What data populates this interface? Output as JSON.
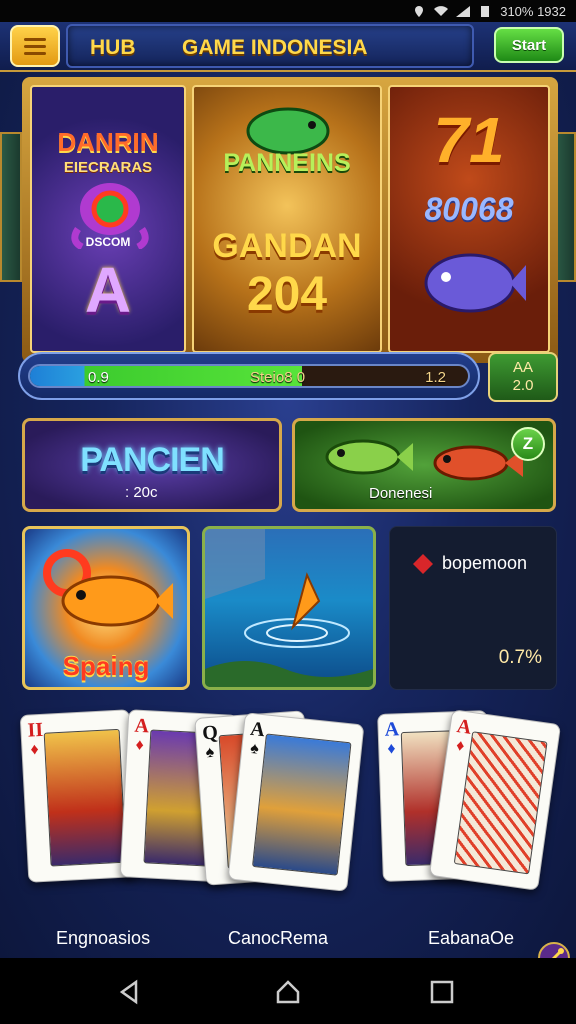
{
  "status_bar": {
    "time": "310% 1932"
  },
  "header": {
    "hub": "HUB",
    "title": "GAME INDONESIA",
    "start_label": "Start"
  },
  "banners": [
    {
      "line1": "DANRIN",
      "line2": "EIECRARAS",
      "line3": "DSCOM",
      "letter": "A"
    },
    {
      "line1": "PANNEINS",
      "line2": "GANDAN",
      "line3": "204"
    },
    {
      "line1": "71",
      "line2": "80068"
    }
  ],
  "progress": {
    "left": "0.9",
    "mid": "Steio8 0",
    "right": "1.2",
    "fill": 0.62
  },
  "aa_badge": {
    "line1": "AA",
    "line2": "2.0"
  },
  "promos": [
    {
      "title": "PANCIEN",
      "sub": ": 20c"
    },
    {
      "badge": "Z",
      "label": "Donenesi"
    }
  ],
  "tiles": [
    {
      "title": "Spaing"
    },
    {},
    {
      "label": "bopemoon",
      "value": "0.7%"
    }
  ],
  "cards": [
    {
      "rank": "II",
      "suit": "♦",
      "color": "red"
    },
    {
      "rank": "A",
      "suit": "♦",
      "color": "red"
    },
    {
      "rank": "Q",
      "suit": "♠",
      "color": "black"
    },
    {
      "rank": "A",
      "suit": "♠",
      "color": "black"
    },
    {
      "rank": "A",
      "suit": "♦",
      "color": "blue"
    },
    {
      "rank": "A",
      "suit": "♦",
      "color": "red"
    }
  ],
  "captions": [
    "Engnoasios",
    "CanocRema",
    "EabanaOe"
  ],
  "nav": {
    "icons": [
      "back-icon",
      "home-icon",
      "recents-icon"
    ]
  }
}
